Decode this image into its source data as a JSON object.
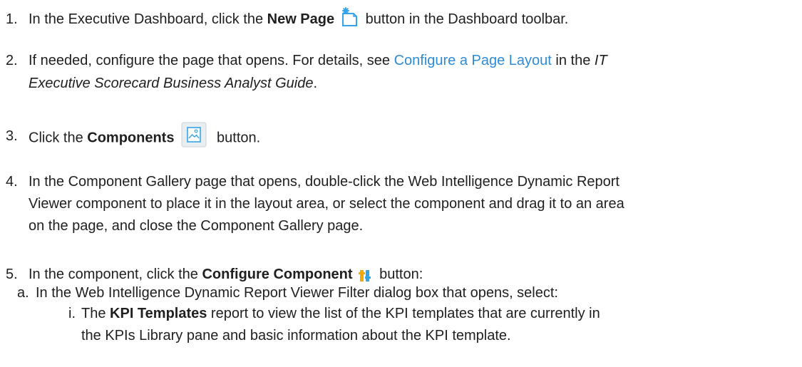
{
  "steps": [
    {
      "num": "1.",
      "t1": "In the Executive Dashboard, click the ",
      "b1": "New Page",
      "t2": " button in the Dashboard toolbar.",
      "icon": "new-page-icon"
    },
    {
      "num": "2.",
      "t1": "If needed, configure the page that opens. For details, see ",
      "link": "Configure a Page Layout",
      "t2": " in the ",
      "i1": "IT",
      "line2_i": "Executive Scorecard Business Analyst Guide",
      "line2_t": "."
    },
    {
      "num": "3.",
      "t1": "Click the ",
      "b1": "Components",
      "t2": " button.",
      "icon": "components-icon"
    },
    {
      "num": "4.",
      "lines": [
        "In the Component Gallery page that opens, double-click the Web Intelligence Dynamic Report",
        "Viewer component to place it in the layout area, or select the component and drag it to an area",
        "on the page, and close the Component Gallery page."
      ]
    },
    {
      "num": "5.",
      "t1": "In the component, click the ",
      "b1": "Configure Component",
      "t2": " button:",
      "icon": "configure-component-icon"
    }
  ],
  "substep_a": {
    "marker": "a.",
    "text": "In the Web Intelligence Dynamic Report Viewer Filter dialog box that opens, select:"
  },
  "substep_i": {
    "marker": "i.",
    "t1": "The ",
    "b1": "KPI Templates",
    "t2": " report to view the list of the KPI templates that are currently in",
    "line2": "the KPIs Library pane and basic information about the KPI template."
  },
  "colors": {
    "text": "#1f1f1f",
    "link": "#2e8bd6",
    "icon_blue": "#35a3e8"
  }
}
